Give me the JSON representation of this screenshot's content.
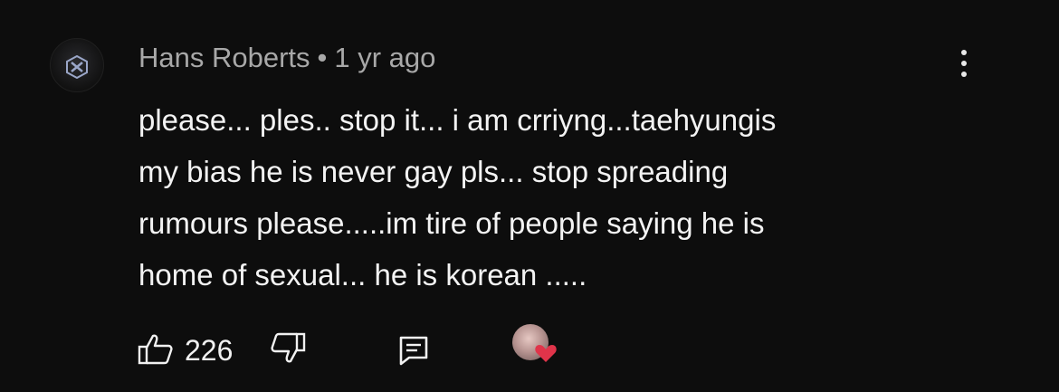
{
  "comment": {
    "author": "Hans Roberts",
    "separator": "•",
    "timestamp": "1 yr ago",
    "text_lines": [
      "please... ples.. stop it... i am crriyng...taehyungis",
      "my bias he is never gay pls... stop spreading",
      "rumours please.....im tire of people saying he is",
      "home of sexual... he is korean ....."
    ],
    "like_count": "226"
  },
  "icons": {
    "more": "more-vertical-icon",
    "like": "thumbs-up-icon",
    "dislike": "thumbs-down-icon",
    "reply": "reply-icon",
    "heart": "creator-heart-icon"
  },
  "colors": {
    "background": "#0d0d0d",
    "text": "#f1f1f1",
    "meta": "#a8a8a8",
    "heart": "#e0344a"
  }
}
